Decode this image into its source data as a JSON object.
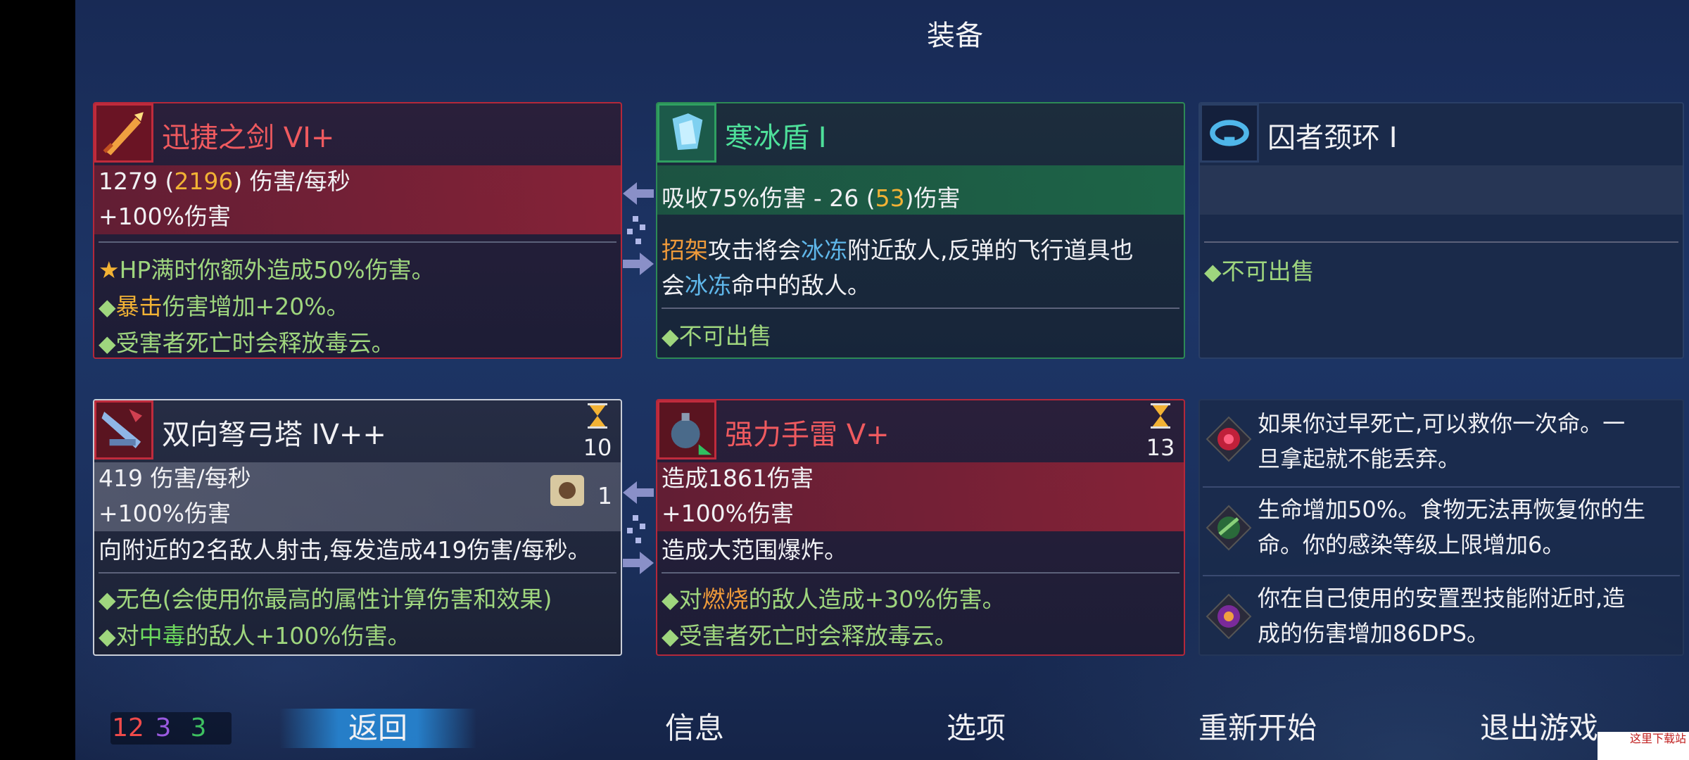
{
  "title": "装备",
  "weapon_sword": {
    "name": "迅捷之剑 VI+",
    "dps_base": "1279",
    "dps_crit": "2196",
    "dps_unit": "伤害/每秒",
    "bonus": "+100%伤害",
    "affix1": "HP满时你额外造成50%伤害。",
    "affix2_hl": "暴击",
    "affix2_rest": "伤害增加+20%。",
    "affix3": "受害者死亡时会释放毒云。"
  },
  "shield": {
    "name": "寒冰盾 I",
    "absorb_pre": "吸收75%伤害 - 26 (",
    "absorb_hl": "53",
    "absorb_post": ")伤害",
    "desc1_a": "招架",
    "desc1_b": "攻击将会",
    "desc1_c": "冰冻",
    "desc1_d": "附近敌人,反弹的飞行道具也",
    "desc2_a": "会",
    "desc2_b": "冰冻",
    "desc2_c": "命中的敌人。",
    "affix1": "不可出售"
  },
  "amulet": {
    "name": "囚者颈环 I",
    "affix1": "不可出售"
  },
  "skill_turret": {
    "name": "双向弩弓塔 IV++",
    "cooldown": "10",
    "dps": "419 伤害/每秒",
    "bonus": "+100%伤害",
    "scroll_count": "1",
    "desc": "向附近的2名敌人射击,每发造成419伤害/每秒。",
    "affix1": "无色(会使用你最高的属性计算伤害和效果)",
    "affix2_a": "对",
    "affix2_hl": "中毒",
    "affix2_b": "的敌人+100%伤害。"
  },
  "skill_grenade": {
    "name": "强力手雷 V+",
    "cooldown": "13",
    "damage": "造成1861伤害",
    "bonus": "+100%伤害",
    "desc": "造成大范围爆炸。",
    "affix1_a": "对",
    "affix1_hl": "燃烧",
    "affix1_b": "的敌人造成+30%伤害。",
    "affix2": "受害者死亡时会释放毒云。"
  },
  "mutations": [
    {
      "text": "如果你过早死亡,可以救你一次命。一旦拿起就不能丢弃。",
      "line1": "如果你过早死亡,可以救你一次命。一",
      "line2": "旦拿起就不能丢弃。"
    },
    {
      "text": "生命增加50%。食物无法再恢复你的生命。你的感染等级上限增加6。",
      "line1": "生命增加50%。食物无法再恢复你的生",
      "line2": "命。你的感染等级上限增加6。"
    },
    {
      "text": "你在自己使用的安置型技能附近时,造成的伤害增加86DPS。",
      "line1": "你在自己使用的安置型技能附近时,造",
      "line2": "成的伤害增加86DPS。"
    }
  ],
  "scores": {
    "red": "12",
    "purple": "3",
    "green": "3"
  },
  "nav": {
    "back": "返回",
    "info": "信息",
    "options": "选项",
    "restart": "重新开始",
    "quit": "退出游戏"
  },
  "watermark": "这里下载站"
}
